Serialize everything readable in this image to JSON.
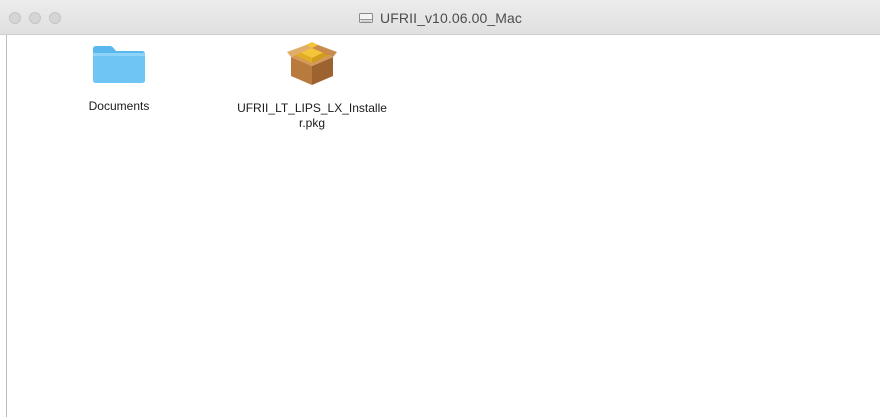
{
  "window": {
    "title": "UFRII_v10.06.00_Mac",
    "title_icon": "disk-icon"
  },
  "files": [
    {
      "label": "Documents",
      "icon": "folder-icon"
    },
    {
      "label": "UFRII_LT_LIPS_LX_Installer.pkg",
      "icon": "package-icon"
    }
  ],
  "colors": {
    "folder": "#6fc6f4",
    "package_box": "#c98a4b",
    "package_top": "#f3c53a"
  }
}
